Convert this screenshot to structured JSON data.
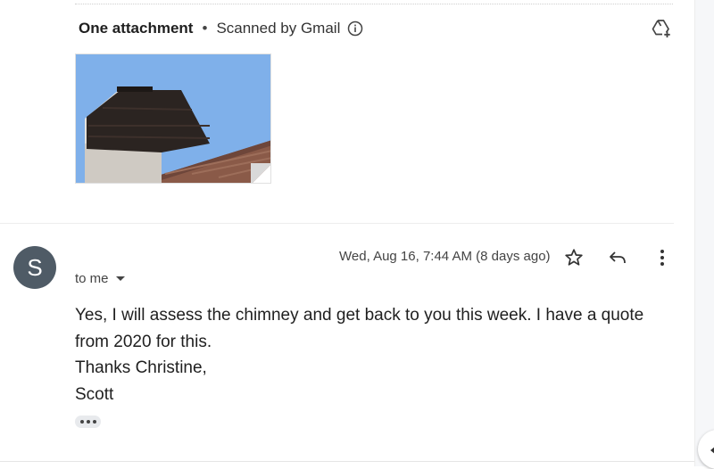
{
  "attachment": {
    "title": "One attachment",
    "separator": "•",
    "scanned_text": "Scanned by Gmail",
    "info_icon": "info-icon",
    "drive_icon": "add-to-drive-icon",
    "thumbnail": "chimney-photo"
  },
  "message": {
    "sender_initial": "S",
    "date": "Wed, Aug 16, 7:44 AM (8 days ago)",
    "recipient": "to me",
    "body_lines": [
      "Yes, I will assess the chimney and get back to you this week. I have a quote from 2020 for this.",
      "Thanks Christine,",
      "Scott"
    ],
    "actions": [
      "star-icon",
      "reply-icon",
      "more-vert-icon"
    ],
    "trimmed_content_icon": "ellipsis-icon"
  },
  "colors": {
    "avatar": "#4f5b66",
    "sky": "#7fb0ea",
    "brick": "#2b2421"
  }
}
